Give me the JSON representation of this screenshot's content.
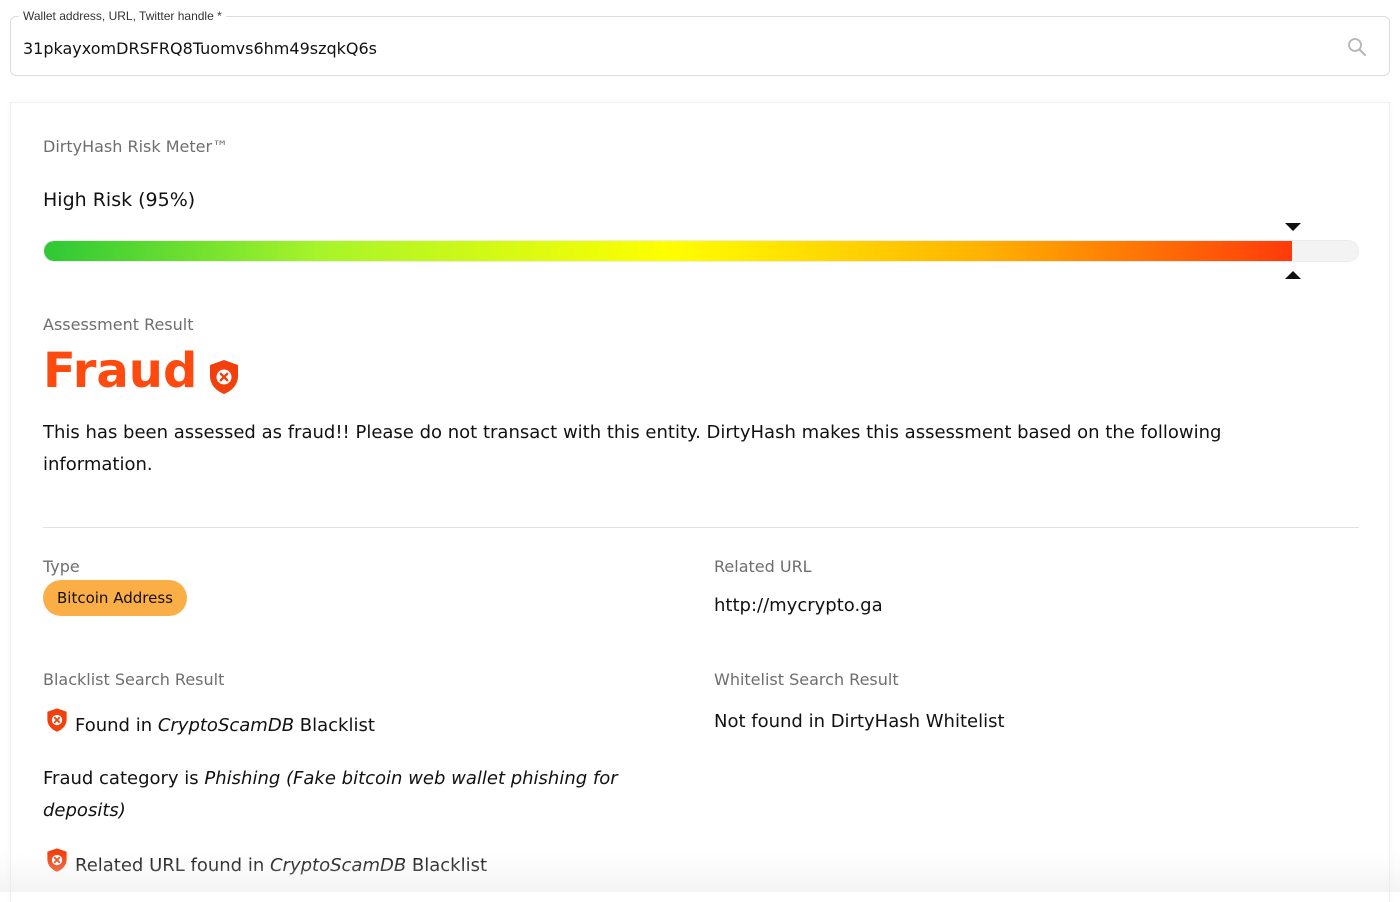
{
  "search": {
    "label": "Wallet address, URL, Twitter handle *",
    "value": "31pkayxomDRSFRQ8Tuomvs6hm49szqkQ6s",
    "icon": "search-icon"
  },
  "meter": {
    "title": "DirtyHash Risk Meter™",
    "risk_text": "High Risk (95%)",
    "risk_percent": 95
  },
  "assessment": {
    "label": "Assessment Result",
    "verdict": "Fraud",
    "verdict_color": "#ff4a0f",
    "icon": "shield-x-icon",
    "description": "This has been assessed as fraud!! Please do not transact with this entity. DirtyHash makes this assessment based on the following information."
  },
  "details": {
    "type_label": "Type",
    "type_value": "Bitcoin Address",
    "type_badge_color": "#fbae46",
    "related_url_label": "Related URL",
    "related_url_value": "http://mycrypto.ga",
    "blacklist_label": "Blacklist Search Result",
    "whitelist_label": "Whitelist Search Result",
    "whitelist_value": "Not found in DirtyHash Whitelist",
    "blacklist_found": {
      "prefix": "Found in ",
      "source": "CryptoScamDB",
      "suffix": " Blacklist"
    },
    "fraud_category": {
      "prefix": "Fraud category is ",
      "category": "Phishing",
      "detail": " (Fake bitcoin web wallet phishing for deposits)"
    },
    "related_url_found": {
      "prefix": "Related URL found in ",
      "source": "CryptoScamDB",
      "suffix": " Blacklist"
    }
  }
}
